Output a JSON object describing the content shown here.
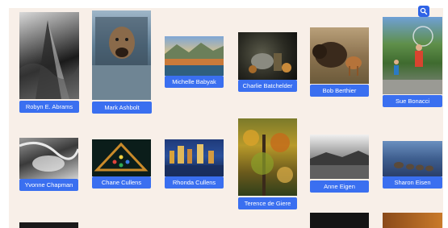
{
  "toolbar": {
    "search_icon": "search-icon"
  },
  "photographers": [
    {
      "name": "Robyn E. Abrams"
    },
    {
      "name": "Mark Ashbolt"
    },
    {
      "name": "Michelle Babyak"
    },
    {
      "name": "Charlie Batchelder"
    },
    {
      "name": "Bob Berthier"
    },
    {
      "name": "Sue Bonacci"
    },
    {
      "name": "Yvonne Chapman"
    },
    {
      "name": "Chane Cullens"
    },
    {
      "name": "Rhonda Cullens"
    },
    {
      "name": "Terence de Giere"
    },
    {
      "name": "Anne Eigen"
    },
    {
      "name": "Sharon Eisen"
    }
  ],
  "colors": {
    "panel_bg": "#f8efe8",
    "label_bg": "#3a6ff0",
    "label_text": "#ffffff",
    "accent": "#2f63e6"
  }
}
